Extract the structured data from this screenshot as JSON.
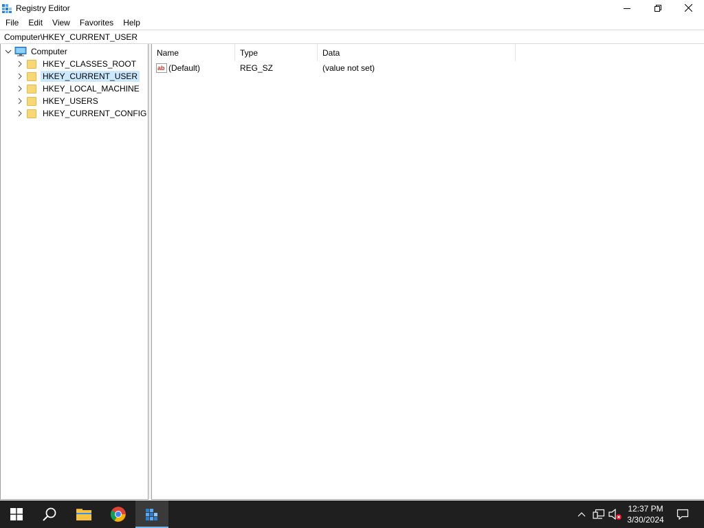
{
  "window": {
    "title": "Registry Editor",
    "icon": "regedit-icon",
    "controls": [
      "minimize-icon",
      "restore-icon",
      "close-icon"
    ]
  },
  "menu": [
    "File",
    "Edit",
    "View",
    "Favorites",
    "Help"
  ],
  "address": {
    "value": "Computer\\HKEY_CURRENT_USER"
  },
  "tree": {
    "root": {
      "label": "Computer",
      "expanded": true,
      "icon": "computer-icon"
    },
    "children": [
      {
        "label": "HKEY_CLASSES_ROOT",
        "selected": false
      },
      {
        "label": "HKEY_CURRENT_USER",
        "selected": true
      },
      {
        "label": "HKEY_LOCAL_MACHINE",
        "selected": false
      },
      {
        "label": "HKEY_USERS",
        "selected": false
      },
      {
        "label": "HKEY_CURRENT_CONFIG",
        "selected": false
      }
    ]
  },
  "list": {
    "columns": [
      "Name",
      "Type",
      "Data"
    ],
    "rows": [
      {
        "icon": "string-value-icon",
        "name": "(Default)",
        "type": "REG_SZ",
        "data": "(value not set)"
      }
    ]
  },
  "taskbar": {
    "apps": [
      "start-icon",
      "search-icon",
      "file-explorer-icon",
      "chrome-icon",
      "regedit-icon"
    ],
    "active_app": "regedit-icon",
    "tray_icons": [
      "chevron-up-icon",
      "network-icon",
      "volume-muted-icon"
    ],
    "time": "12:37 PM",
    "date": "3/30/2024",
    "notification_icon": "notification-icon"
  },
  "colors": {
    "selection": "#cce8ff",
    "taskbar": "#1f1f1f",
    "folder": "#f8d775",
    "accent": "#76b9ed"
  }
}
